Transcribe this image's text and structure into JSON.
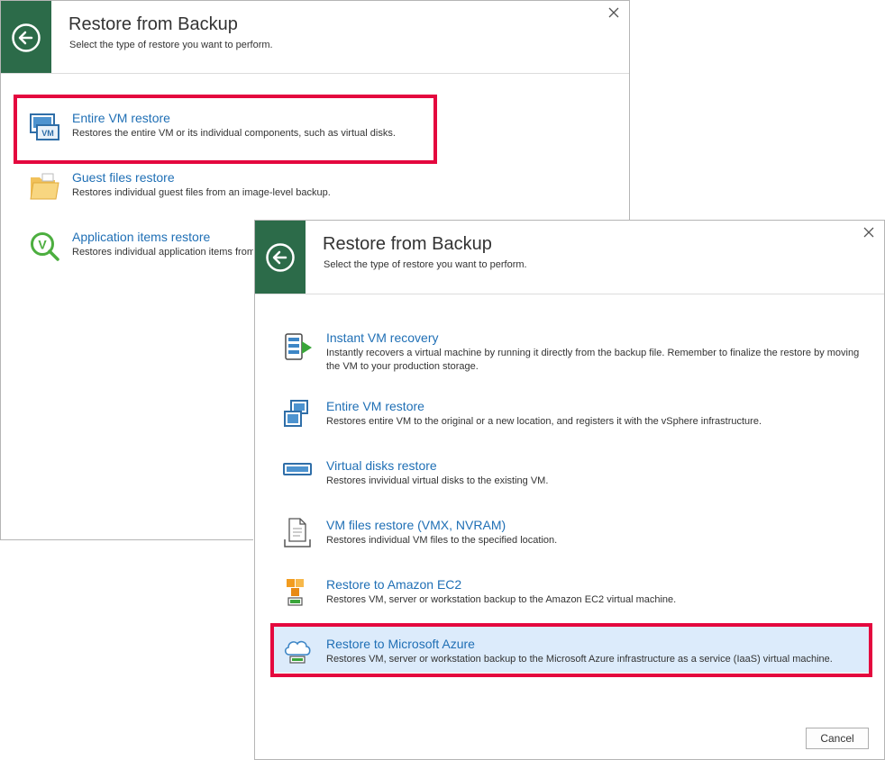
{
  "back_dialog": {
    "title": "Restore from Backup",
    "subtitle": "Select the type of restore you want to perform.",
    "options": [
      {
        "title": "Entire VM restore",
        "description": "Restores the entire VM or its individual components, such as virtual disks."
      },
      {
        "title": "Guest files restore",
        "description": "Restores individual guest files from an image-level backup."
      },
      {
        "title": "Application items restore",
        "description": "Restores individual application items from"
      }
    ]
  },
  "front_dialog": {
    "title": "Restore from Backup",
    "subtitle": "Select the type of restore you want to perform.",
    "options": [
      {
        "title": "Instant VM recovery",
        "description": "Instantly recovers a virtual machine by running it directly from the backup file. Remember to finalize the restore by moving the VM to your production storage."
      },
      {
        "title": "Entire VM restore",
        "description": "Restores entire VM to the original or a new location, and registers it with the vSphere infrastructure."
      },
      {
        "title": "Virtual disks restore",
        "description": "Restores invividual virtual disks to the existing VM."
      },
      {
        "title": "VM files restore (VMX, NVRAM)",
        "description": "Restores individual VM files to the specified location."
      },
      {
        "title": "Restore to Amazon EC2",
        "description": "Restores VM, server or workstation backup to the Amazon EC2 virtual machine."
      },
      {
        "title": "Restore to Microsoft Azure",
        "description": "Restores VM, server or workstation backup to the Microsoft Azure infrastructure as a service (IaaS) virtual machine."
      }
    ],
    "cancel_label": "Cancel"
  },
  "colors": {
    "header_green": "#2c6b49",
    "link_blue": "#1f6fb5",
    "highlight_red": "#e4083e",
    "selection_blue": "#dcebfb"
  },
  "icons": {
    "back": "back-arrow-icon",
    "close": "close-icon",
    "entire_vm": "vm-icon",
    "guest_files": "folder-icon",
    "application_items": "veeam-explorer-icon",
    "instant_recovery": "database-play-icon",
    "vm_restore": "vm-copy-icon",
    "virtual_disk": "disk-icon",
    "vm_files": "document-icon",
    "amazon": "amazon-ec2-icon",
    "azure": "cloud-icon"
  }
}
